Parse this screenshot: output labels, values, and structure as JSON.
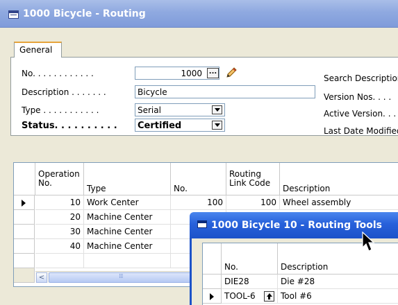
{
  "window": {
    "title": "1000 Bicycle - Routing"
  },
  "tabs": [
    {
      "label": "General"
    }
  ],
  "fields": {
    "no": {
      "label": "No. . . . . . . . . . . .",
      "value": "1000"
    },
    "description": {
      "label": "Description . . . . . . .",
      "value": "Bicycle"
    },
    "type": {
      "label": "Type . . . . . . . . . . .",
      "value": "Serial"
    },
    "status": {
      "label": "Status. . . . . . . . . .",
      "value": "Certified"
    }
  },
  "right_fields": {
    "search_description": "Search Description",
    "version_nos": "Version Nos. . . .",
    "active_version": "Active Version. . .",
    "last_date_modified": "Last Date Modified"
  },
  "routing_lines": {
    "headers": {
      "operation_no": "Operation No.",
      "type": "Type",
      "no": "No.",
      "routing_link_code": "Routing Link Code",
      "description": "Description"
    },
    "rows": [
      {
        "operation_no": "10",
        "type": "Work Center",
        "no": "100",
        "routing_link_code": "100",
        "description": "Wheel assembly"
      },
      {
        "operation_no": "20",
        "type": "Machine Center",
        "no": "",
        "routing_link_code": "",
        "description": ""
      },
      {
        "operation_no": "30",
        "type": "Machine Center",
        "no": "",
        "routing_link_code": "",
        "description": ""
      },
      {
        "operation_no": "40",
        "type": "Machine Center",
        "no": "",
        "routing_link_code": "",
        "description": ""
      }
    ],
    "scroll_left_glyph": "<"
  },
  "routing_tools_window": {
    "title": "1000 Bicycle 10 - Routing Tools",
    "headers": {
      "no": "No.",
      "description": "Description"
    },
    "rows": [
      {
        "no": "DIE28",
        "description": "Die #28"
      },
      {
        "no": "TOOL-6",
        "description": "Tool #6"
      }
    ]
  },
  "colors": {
    "inactive_title": "#8fa9e0",
    "active_title": "#2760da",
    "tab_accent": "#e6a33b",
    "window_bg": "#ece9d8"
  },
  "icons": [
    "form-icon",
    "ellipsis-icon",
    "pencil-icon",
    "dropdown-icon",
    "row-pointer-icon",
    "lookup-icon",
    "mouse-cursor-icon"
  ]
}
